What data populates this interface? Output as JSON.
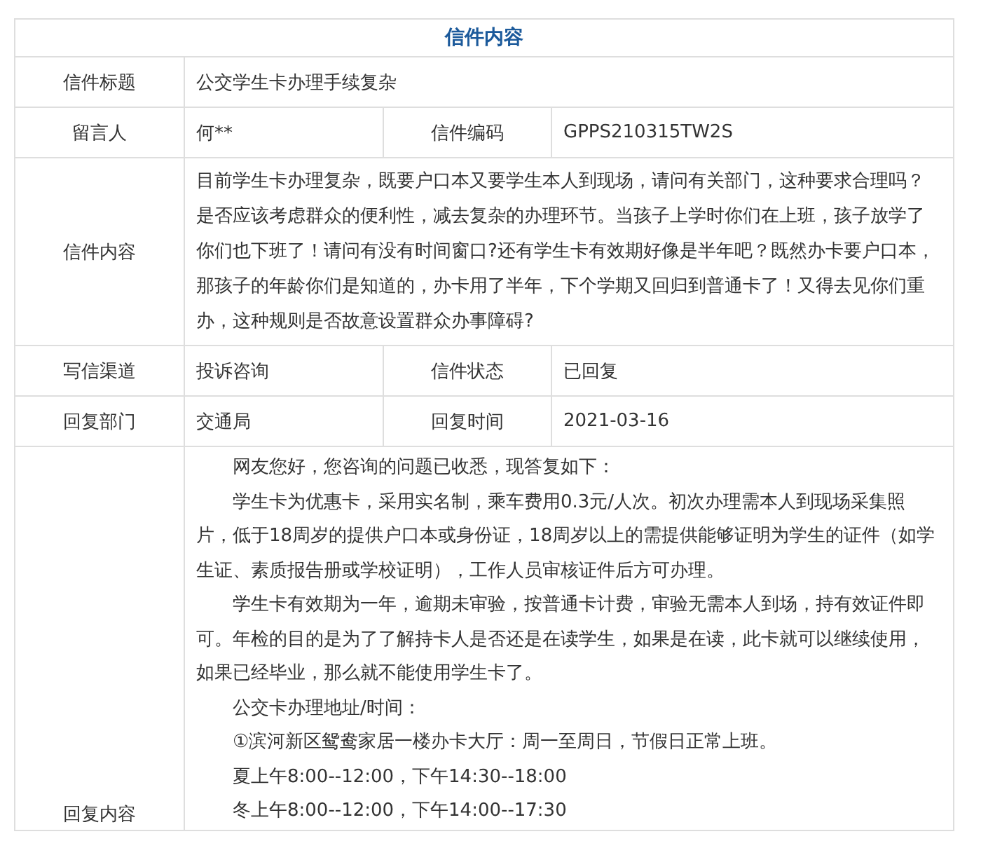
{
  "title": "信件内容",
  "rows": [
    {
      "kind": "single",
      "label": "信件标题",
      "value": "公交学生卡办理手续复杂"
    },
    {
      "kind": "pair",
      "label": "留言人",
      "value": "何**",
      "label2": "信件编码",
      "value2": "GPPS210315TW2S"
    },
    {
      "kind": "text",
      "label": "信件内容",
      "value": "目前学生卡办理复杂，既要户口本又要学生本人到现场，请问有关部门，这种要求合理吗？是否应该考虑群众的便利性，减去复杂的办理环节。当孩子上学时你们在上班，孩子放学了你们也下班了！请问有没有时间窗口?还有学生卡有效期好像是半年吧？既然办卡要户口本，那孩子的年龄你们是知道的，办卡用了半年，下个学期又回归到普通卡了！又得去见你们重办，这种规则是否故意设置群众办事障碍?"
    },
    {
      "kind": "pair",
      "label": "写信渠道",
      "value": "投诉咨询",
      "label2": "信件状态",
      "value2": "已回复"
    },
    {
      "kind": "pair",
      "label": "回复部门",
      "value": "交通局",
      "label2": "回复时间",
      "value2": "2021-03-16"
    },
    {
      "kind": "paragraphs",
      "label": "回复内容",
      "paragraphs": [
        "网友您好，您咨询的问题已收悉，现答复如下：",
        "学生卡为优惠卡，采用实名制，乘车费用0.3元/人次。初次办理需本人到现场采集照片，低于18周岁的提供户口本或身份证，18周岁以上的需提供能够证明为学生的证件（如学生证、素质报告册或学校证明），工作人员审核证件后方可办理。",
        "学生卡有效期为一年，逾期未审验，按普通卡计费，审验无需本人到场，持有效证件即可。年检的目的是为了了解持卡人是否还是在读学生，如果是在读，此卡就可以继续使用，如果已经毕业，那么就不能使用学生卡了。",
        "公交卡办理地址/时间：",
        "①滨河新区鸳鸯家居一楼办卡大厅：周一至周日，节假日正常上班。",
        "夏上午8:00--12:00，下午14:30--18:00",
        "冬上午8:00--12:00，下午14:00--17:30"
      ]
    }
  ]
}
